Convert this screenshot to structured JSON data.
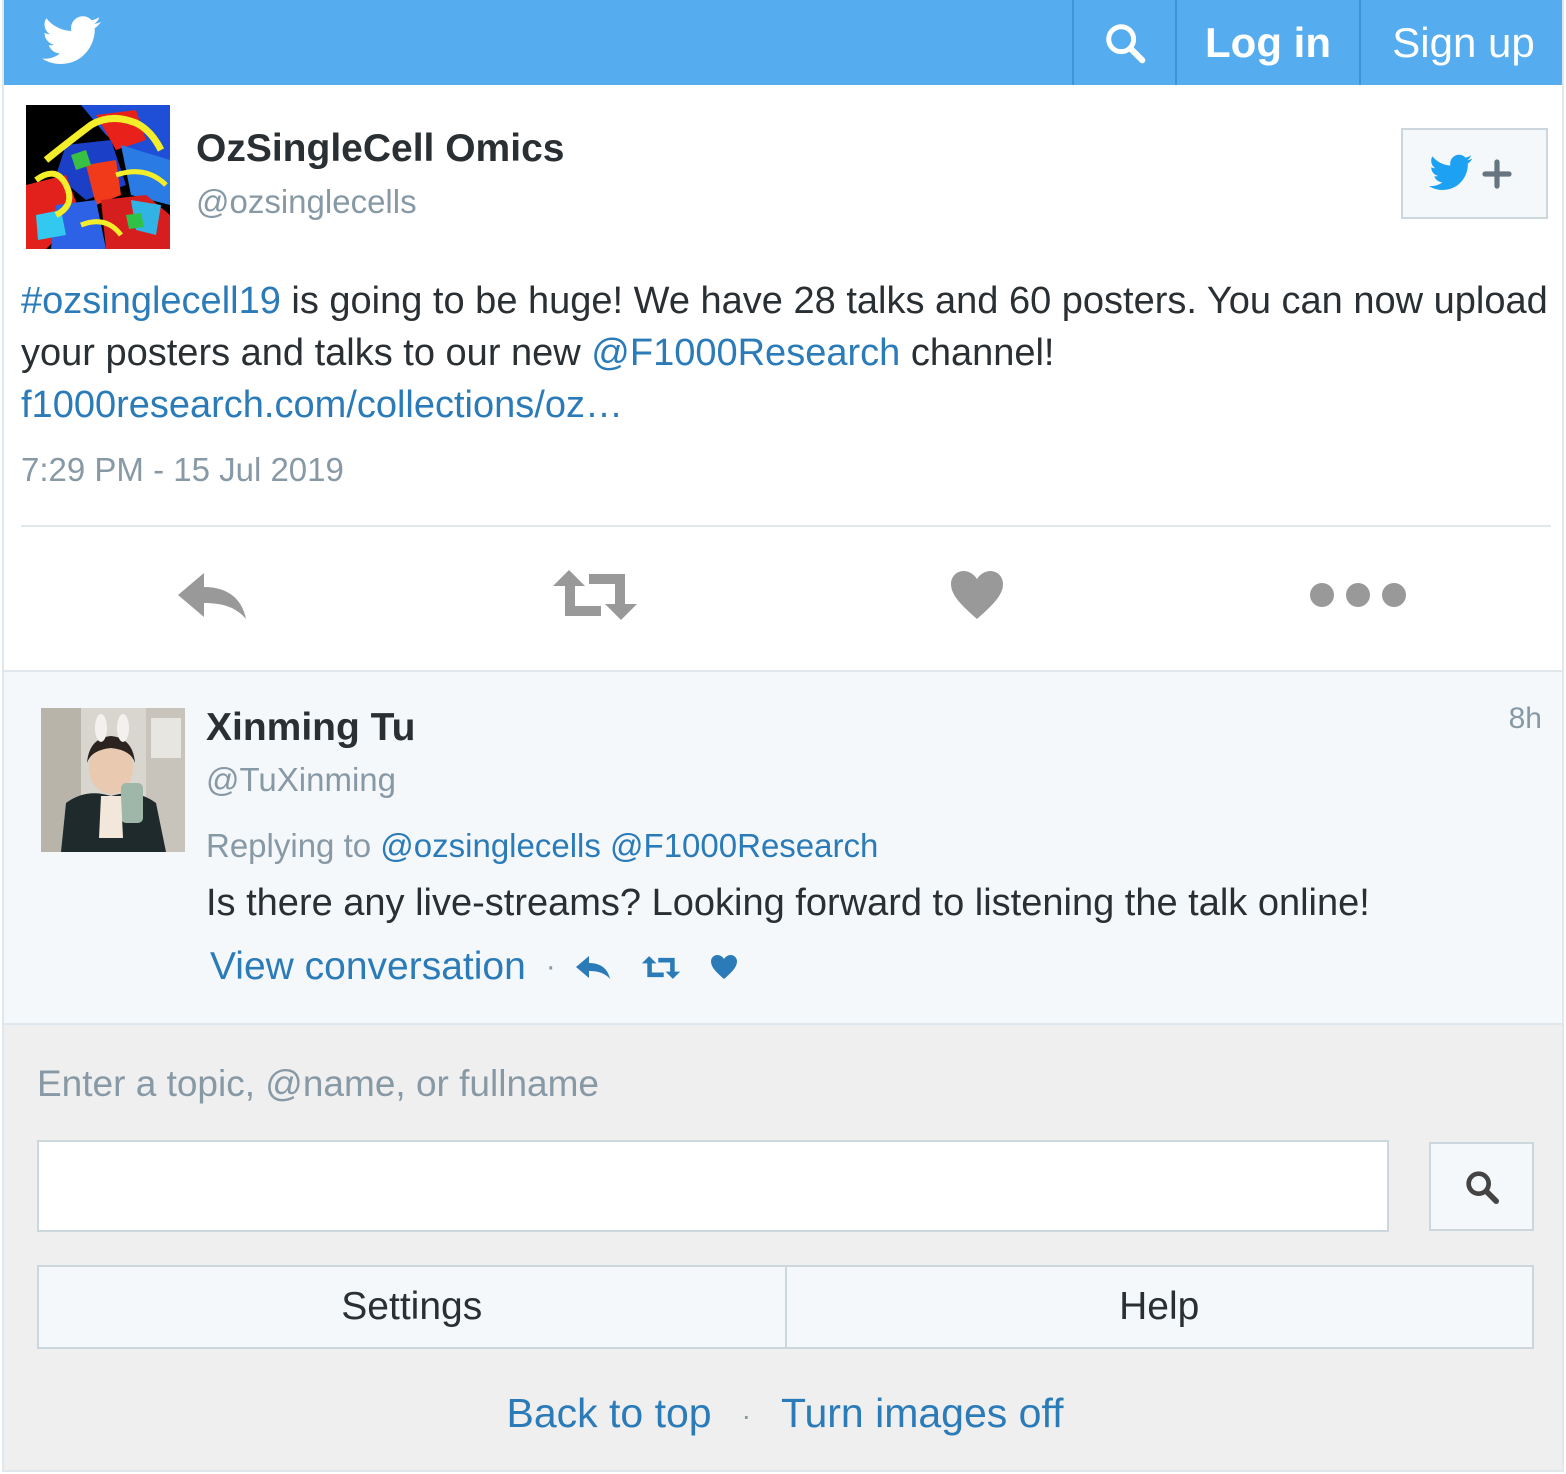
{
  "header": {
    "logo": "twitter-bird-icon",
    "search_icon": "search-icon",
    "login_label": "Log in",
    "signup_label": "Sign up"
  },
  "tweet": {
    "author_name": "OzSingleCell Omics",
    "author_handle": "@ozsinglecells",
    "follow_icon": "follow-bird-plus-icon",
    "text_parts": {
      "hashtag": "#ozsinglecell19",
      "text1": " is going to be huge! We have 28 talks and 60 posters. You can now upload your posters and talks to our new ",
      "mention": "@F1000Research",
      "text2": " channel!",
      "link": "f1000research.com/collections/oz…"
    },
    "timestamp": "7:29 PM - 15 Jul 2019",
    "actions": [
      "reply-icon",
      "retweet-icon",
      "like-icon",
      "more-icon"
    ]
  },
  "reply": {
    "author_name": "Xinming Tu",
    "author_handle": "@TuXinming",
    "time": "8h",
    "replying_prefix": "Replying to",
    "replying_to_1": "@ozsinglecells",
    "replying_to_2": "@F1000Research",
    "text": "Is there any live-streams? Looking forward to listening the talk online!",
    "view_conversation": "View conversation",
    "separator": "·"
  },
  "footer": {
    "search_label": "Enter a topic, @name, or fullname",
    "search_value": "",
    "settings_label": "Settings",
    "help_label": "Help",
    "back_to_top": "Back to top",
    "separator": "·",
    "turn_images_off": "Turn images off"
  },
  "colors": {
    "brand_blue": "#55acee",
    "link_blue": "#2b7bb9",
    "muted_gray": "#8899a6",
    "text_dark": "#292f33",
    "action_gray": "#aab8c2"
  }
}
